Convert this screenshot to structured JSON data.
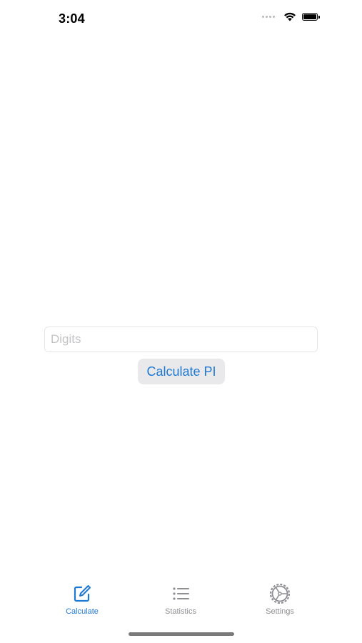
{
  "status_bar": {
    "time": "3:04",
    "icons": [
      "cellular-dots-icon",
      "wifi-icon",
      "battery-icon"
    ]
  },
  "form": {
    "digits_placeholder": "Digits",
    "digits_value": "",
    "calculate_label": "Calculate PI"
  },
  "tab_bar": {
    "items": [
      {
        "label": "Calculate",
        "icon": "compose-icon",
        "active": true
      },
      {
        "label": "Statistics",
        "icon": "list-icon",
        "active": false
      },
      {
        "label": "Settings",
        "icon": "gear-icon",
        "active": false
      }
    ]
  },
  "colors": {
    "accent": "#1f78d1",
    "inactive": "#8e8e93",
    "button_bg": "#e9e9eb"
  }
}
